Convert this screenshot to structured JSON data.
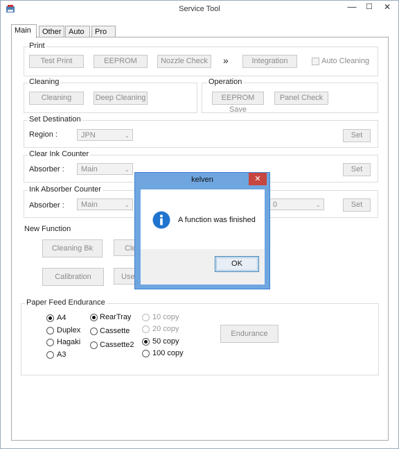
{
  "window": {
    "title": "Service Tool",
    "minimize": "—",
    "maximize": "☐",
    "close": "✕"
  },
  "tabs": [
    "Main",
    "Other",
    "Auto",
    "Pro"
  ],
  "print": {
    "title": "Print",
    "test_print": "Test Print",
    "eeprom": "EEPROM",
    "nozzle_check": "Nozzle Check",
    "arrow": "»",
    "integration": "Integration",
    "auto_cleaning": "Auto Cleaning"
  },
  "cleaning": {
    "title": "Cleaning",
    "cleaning": "Cleaning",
    "deep_cleaning": "Deep Cleaning"
  },
  "operation": {
    "title": "Operation",
    "eeprom_save": "EEPROM Save",
    "panel_check": "Panel Check"
  },
  "set_destination": {
    "title": "Set Destination",
    "region_label": "Region :",
    "region_value": "JPN",
    "set": "Set"
  },
  "clear_ink": {
    "title": "Clear Ink Counter",
    "absorber_label": "Absorber :",
    "absorber_value": "Main",
    "set": "Set"
  },
  "ink_absorber": {
    "title": "Ink Absorber Counter",
    "absorber_label": "Absorber :",
    "absorber_value": "Main",
    "value2": "0",
    "set": "Set"
  },
  "new_function": {
    "title": "New Function",
    "cleaning_bk": "Cleaning Bk",
    "btn2_partial": "Cle",
    "calibration": "Calibration",
    "btn4_partial": "Use"
  },
  "paper_feed": {
    "title": "Paper Feed Endurance",
    "sizes": [
      "A4",
      "Duplex",
      "Hagaki",
      "A3"
    ],
    "trays": [
      "RearTray",
      "Cassette",
      "Cassette2"
    ],
    "copies": [
      "10 copy",
      "20 copy",
      "50 copy",
      "100 copy"
    ],
    "endurance": "Endurance"
  },
  "dialog": {
    "title": "kelven",
    "close": "✕",
    "message": "A function was finished",
    "ok": "OK",
    "icon": "info-icon"
  }
}
